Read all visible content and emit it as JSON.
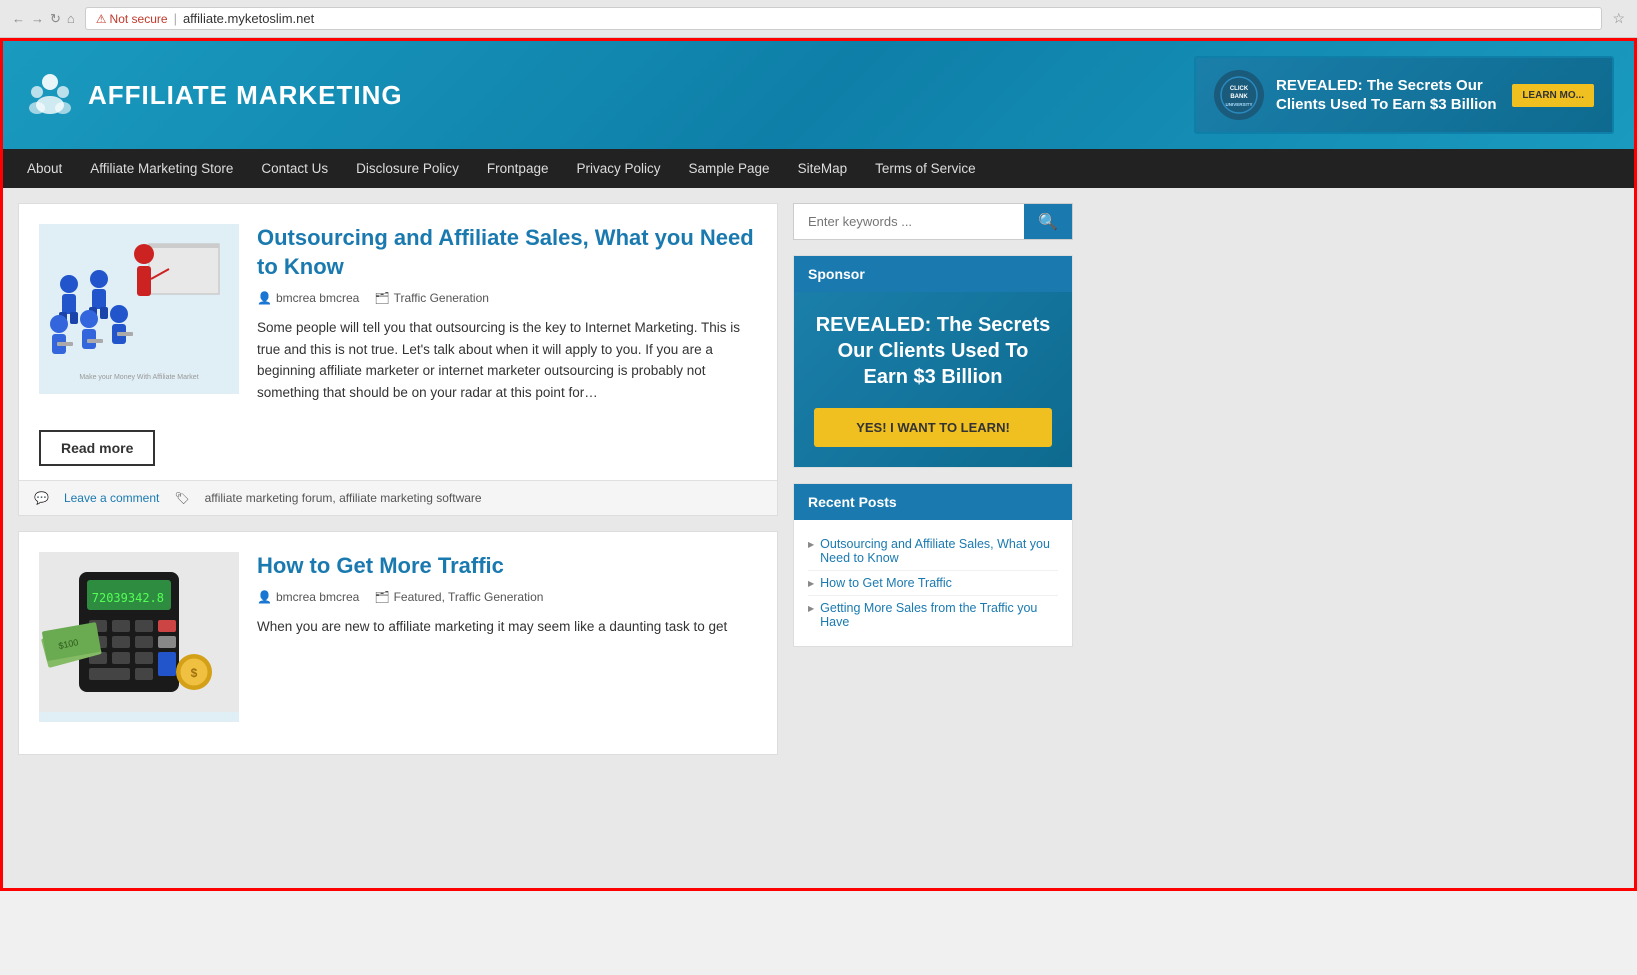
{
  "browser": {
    "not_secure_label": "Not secure",
    "url": "affiliate.myketoslim.net",
    "star_icon": "☆"
  },
  "header": {
    "logo_text": "AFFILIATE MARKETING",
    "logo_icon_label": "affiliate-icon",
    "ad_text": "REVEALED: The Secrets Our Clients Used To Earn $3 Billion",
    "learn_more_label": "LEARN MO...",
    "clickbank_label": "CLICKBANK UNIVERSITY"
  },
  "nav": {
    "items": [
      {
        "label": "About",
        "href": "#"
      },
      {
        "label": "Affiliate Marketing Store",
        "href": "#"
      },
      {
        "label": "Contact Us",
        "href": "#"
      },
      {
        "label": "Disclosure Policy",
        "href": "#"
      },
      {
        "label": "Frontpage",
        "href": "#"
      },
      {
        "label": "Privacy Policy",
        "href": "#"
      },
      {
        "label": "Sample Page",
        "href": "#"
      },
      {
        "label": "SiteMap",
        "href": "#"
      },
      {
        "label": "Terms of Service",
        "href": "#"
      }
    ]
  },
  "articles": [
    {
      "title": "Outsourcing and Affiliate Sales, What you Need to Know",
      "author": "bmcrea bmcrea",
      "category": "Traffic Generation",
      "excerpt": "Some people will tell you that outsourcing is the key to Internet Marketing.  This is true and this is not true.  Let's talk about when it will apply to you. If you are a beginning affiliate marketer or internet marketer outsourcing is probably not something that should be on your radar at this point for…",
      "read_more_label": "Read more",
      "comment_label": "Leave a comment",
      "tags": "affiliate marketing forum, affiliate marketing software",
      "thumb_caption": "Make your Money With Affiliate Market"
    },
    {
      "title": "How to Get More Traffic",
      "author": "bmcrea bmcrea",
      "category": "Featured, Traffic Generation",
      "excerpt": "When you are new to affiliate marketing it may seem like a daunting task to get",
      "thumb_caption": ""
    }
  ],
  "sidebar": {
    "search_placeholder": "Enter keywords ...",
    "search_btn_icon": "🔍",
    "sponsor_title": "Sponsor",
    "sponsor_ad_text": "REVEALED: The Secrets Our Clients Used To Earn $3 Billion",
    "sponsor_btn_label": "YES! I WANT TO LEARN!",
    "recent_posts_title": "Recent Posts",
    "recent_posts": [
      "Outsourcing and Affiliate Sales, What you Need to Know",
      "How to Get More Traffic",
      "Getting More Sales from the Traffic you Have"
    ]
  },
  "icons": {
    "user": "👤",
    "folder": "🗂",
    "tag": "🏷",
    "comment": "💬",
    "arrow": "▶"
  }
}
